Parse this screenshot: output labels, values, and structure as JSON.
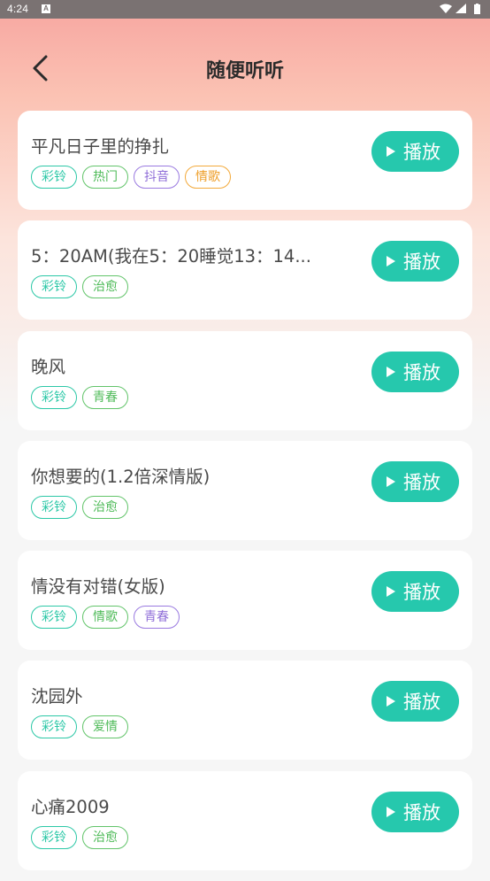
{
  "status_bar": {
    "time": "4:24",
    "notification_icon": "A",
    "icons": [
      "wifi-icon",
      "signal-icon",
      "battery-icon"
    ]
  },
  "header": {
    "back_icon": "chevron-left-icon",
    "title": "随便听听"
  },
  "colors": {
    "accent": "#26c8ad",
    "tag_teal": "#2cc8a7",
    "tag_green": "#4fbb59",
    "tag_purple": "#8f6ed8",
    "tag_orange": "#ee9f2a",
    "gradient_top": "#f7a5a0"
  },
  "songs": [
    {
      "title": "平凡日子里的挣扎",
      "tags": [
        {
          "label": "彩铃",
          "color": "teal"
        },
        {
          "label": "热门",
          "color": "green"
        },
        {
          "label": "抖音",
          "color": "purple"
        },
        {
          "label": "情歌",
          "color": "orange"
        }
      ],
      "play_label": "播放"
    },
    {
      "title": "5：20AM(我在5：20睡觉13：14...",
      "tags": [
        {
          "label": "彩铃",
          "color": "teal"
        },
        {
          "label": "治愈",
          "color": "green"
        }
      ],
      "play_label": "播放"
    },
    {
      "title": "晚风",
      "tags": [
        {
          "label": "彩铃",
          "color": "teal"
        },
        {
          "label": "青春",
          "color": "green"
        }
      ],
      "play_label": "播放"
    },
    {
      "title": "你想要的(1.2倍深情版)",
      "tags": [
        {
          "label": "彩铃",
          "color": "teal"
        },
        {
          "label": "治愈",
          "color": "green"
        }
      ],
      "play_label": "播放"
    },
    {
      "title": "情没有对错(女版)",
      "tags": [
        {
          "label": "彩铃",
          "color": "teal"
        },
        {
          "label": "情歌",
          "color": "green"
        },
        {
          "label": "青春",
          "color": "purple"
        }
      ],
      "play_label": "播放"
    },
    {
      "title": "沈园外",
      "tags": [
        {
          "label": "彩铃",
          "color": "teal"
        },
        {
          "label": "爱情",
          "color": "green"
        }
      ],
      "play_label": "播放"
    },
    {
      "title": "心痛2009",
      "tags": [
        {
          "label": "彩铃",
          "color": "teal"
        },
        {
          "label": "治愈",
          "color": "green"
        }
      ],
      "play_label": "播放"
    }
  ]
}
